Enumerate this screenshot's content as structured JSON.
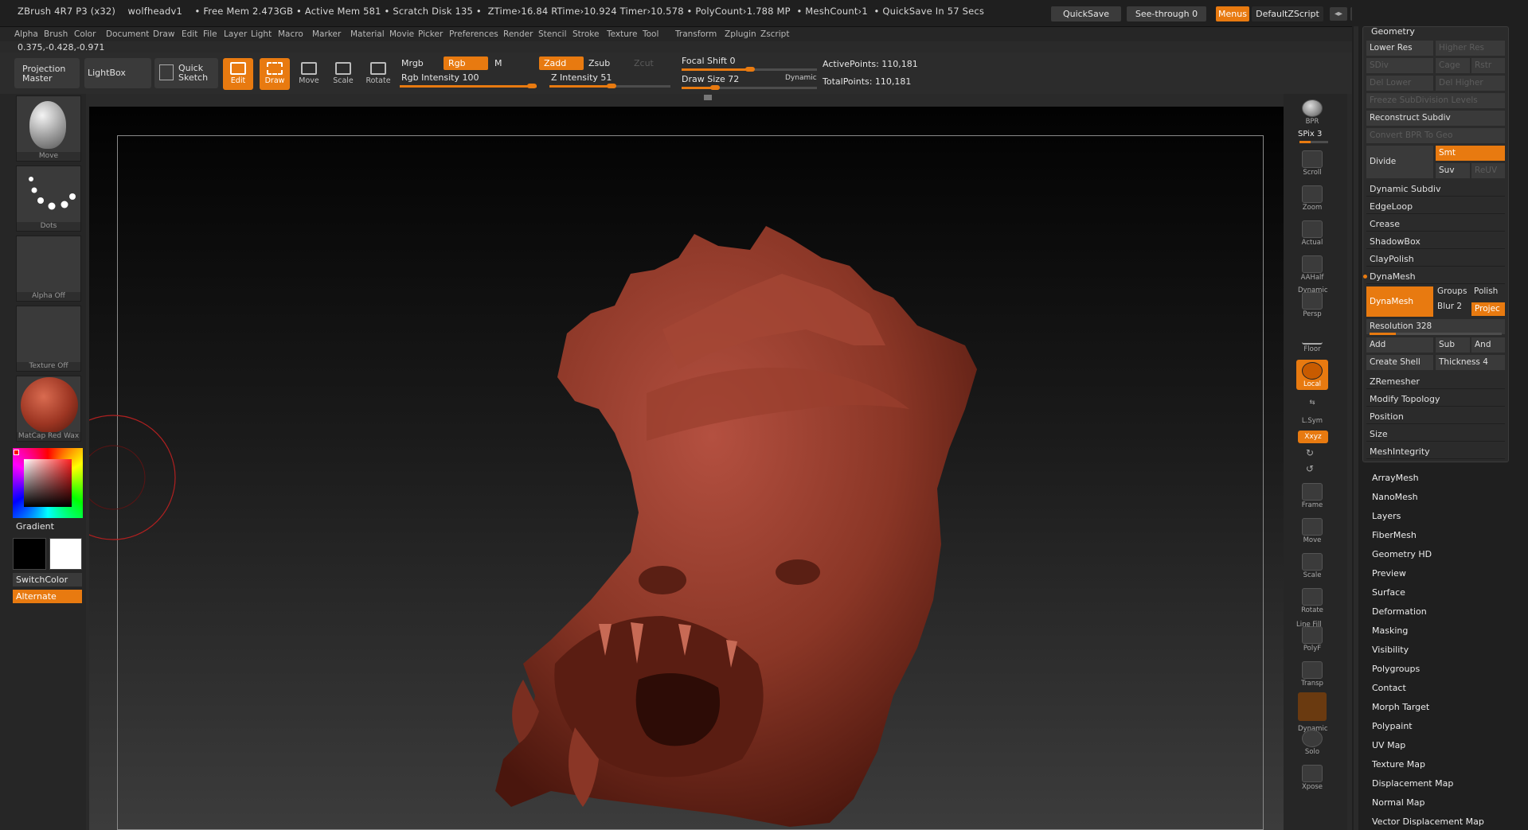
{
  "titlebar": {
    "text": "ZBrush 4R7 P3 (x32)    wolfheadv1    • Free Mem 2.473GB • Active Mem 581 • Scratch Disk 135 •  ZTime›16.84 RTime›10.924 Timer›10.578 • PolyCount›1.788 MP  • MeshCount›1  • QuickSave In 57 Secs",
    "quicksave": "QuickSave",
    "seethrough": "See-through  0",
    "menus": "Menus",
    "defaultzscript": "DefaultZScript"
  },
  "menubar": [
    "Alpha",
    "Brush",
    "Color",
    "Document",
    "Draw",
    "Edit",
    "File",
    "Layer",
    "Light",
    "Macro",
    "Marker",
    "Material",
    "Movie",
    "Picker",
    "Preferences",
    "Render",
    "Stencil",
    "Stroke",
    "Texture",
    "Tool",
    "Transform",
    "Zplugin",
    "Zscript"
  ],
  "coords": "0.375,-0.428,-0.971",
  "toolbar": {
    "projection_master": "Projection\nMaster",
    "lightbox": "LightBox",
    "quick_sketch": "Quick\nSketch",
    "edit": "Edit",
    "draw": "Draw",
    "move": "Move",
    "scale": "Scale",
    "rotate": "Rotate",
    "mrgb": "Mrgb",
    "rgb": "Rgb",
    "m": "M",
    "zadd": "Zadd",
    "zsub": "Zsub",
    "zcut": "Zcut",
    "rgb_intensity": "Rgb  Intensity 100",
    "z_intensity": "Z  Intensity 51",
    "focal_shift": "Focal  Shift 0",
    "draw_size": "Draw  Size 72",
    "dynamic": "Dynamic",
    "active_points": "ActivePoints: 110,181",
    "total_points": "TotalPoints: 110,181"
  },
  "leftshelf": {
    "brush_label": "Move",
    "stroke_label": "Dots",
    "alpha_label": "Alpha  Off",
    "texture_label": "Texture  Off",
    "material_label": "MatCap  Red  Wax",
    "gradient": "Gradient",
    "switchcolor": "SwitchColor",
    "alternate": "Alternate"
  },
  "rightshelf": {
    "bpr": "BPR",
    "spix": "SPix 3",
    "scroll": "Scroll",
    "zoom": "Zoom",
    "actual": "Actual",
    "aahalf": "AAHalf",
    "dynamic_persp": "Dynamic",
    "persp": "Persp",
    "floor": "Floor",
    "local": "Local",
    "lsym": "L.Sym",
    "xyz": "Xxyz",
    "frame": "Frame",
    "move": "Move",
    "scale": "Scale",
    "rotate": "Rotate",
    "linefill": "Line Fill",
    "polyf": "PolyF",
    "transp": "Transp",
    "dynamic_solo": "Dynamic",
    "solo": "Solo",
    "xpose": "Xpose"
  },
  "geometry": {
    "header": "Geometry",
    "lower_res": "Lower Res",
    "higher_res": "Higher Res",
    "sdiv": "SDiv",
    "cage": "Cage",
    "rstr": "Rstr",
    "del_lower": "Del Lower",
    "del_higher": "Del Higher",
    "freeze": "Freeze SubDivision Levels",
    "reconstruct": "Reconstruct Subdiv",
    "convert_bpr": "Convert BPR To Geo",
    "divide": "Divide",
    "smt": "Smt",
    "suv": "Suv",
    "reuv": "ReUV",
    "sections": [
      "Dynamic Subdiv",
      "EdgeLoop",
      "Crease",
      "ShadowBox",
      "ClayPolish",
      "DynaMesh"
    ],
    "dynamesh_btn": "DynaMesh",
    "groups": "Groups",
    "polish": "Polish",
    "blur": "Blur 2",
    "project": "Projec",
    "resolution": "Resolution 328",
    "add": "Add",
    "sub": "Sub",
    "and": "And",
    "create_shell": "Create Shell",
    "thickness": "Thickness 4",
    "sections2": [
      "ZRemesher",
      "Modify Topology",
      "Position",
      "Size",
      "MeshIntegrity"
    ]
  },
  "tool_subpalettes": [
    "ArrayMesh",
    "NanoMesh",
    "Layers",
    "FiberMesh",
    "Geometry HD",
    "Preview",
    "Surface",
    "Deformation",
    "Masking",
    "Visibility",
    "Polygroups",
    "Contact",
    "Morph Target",
    "Polypaint",
    "UV Map",
    "Texture Map",
    "Displacement Map",
    "Normal Map",
    "Vector Displacement Map"
  ],
  "colors": {
    "accent": "#e87a10",
    "model": "#8e3a2a",
    "panel": "#2b2b2b"
  }
}
